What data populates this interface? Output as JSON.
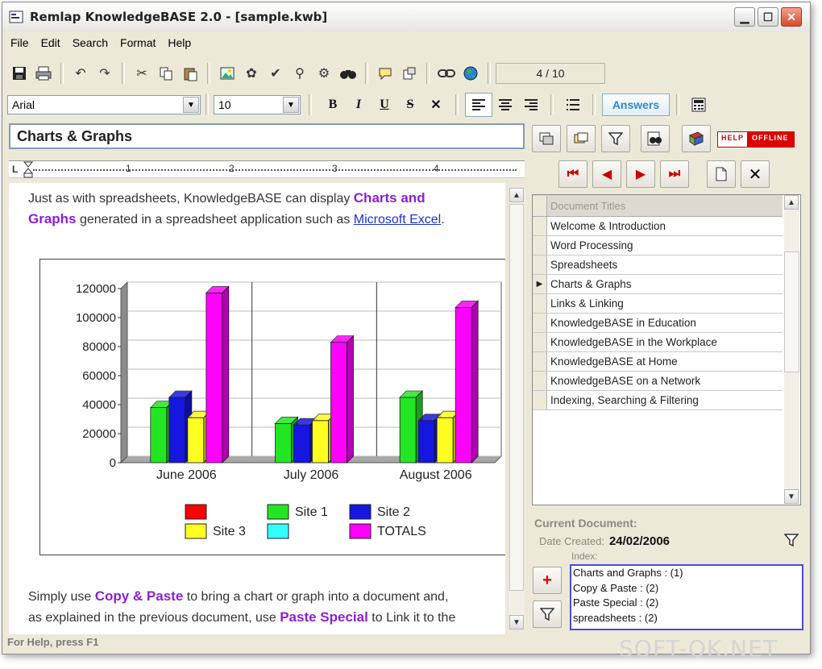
{
  "window": {
    "title": "Remlap KnowledgeBASE 2.0  -  [sample.kwb]"
  },
  "menu": {
    "items": [
      "File",
      "Edit",
      "Search",
      "Format",
      "Help"
    ]
  },
  "toolbar": {
    "page_indicator": "4 / 10"
  },
  "format_toolbar": {
    "font_name": "Arial",
    "font_size": "10",
    "answers_label": "Answers"
  },
  "document": {
    "title": "Charts & Graphs",
    "intro_text_1": "Just as with spreadsheets, KnowledgeBASE can display ",
    "intro_highlight_1": "Charts and",
    "intro_highlight_2": "Graphs",
    "intro_text_2": " generated in a spreadsheet application such as ",
    "intro_link": "Microsoft Excel",
    "intro_text_3": ".",
    "outro_text_1": "Simply use ",
    "outro_highlight_1": "Copy & Paste",
    "outro_text_2": " to bring a chart or graph into a document and,",
    "outro_text_3": "as explained in the previous document, use ",
    "outro_highlight_2": "Paste Special",
    "outro_text_4": " to Link it to the"
  },
  "ruler": {
    "marks": [
      "1",
      "2",
      "3",
      "4"
    ]
  },
  "chart_data": {
    "type": "bar",
    "categories": [
      "June 2006",
      "July 2006",
      "August 2006"
    ],
    "series": [
      {
        "name": "",
        "color": "#ff0000",
        "values": [
          0,
          0,
          0
        ]
      },
      {
        "name": "Site 1",
        "color": "#22e622",
        "values": [
          38000,
          27000,
          45000
        ]
      },
      {
        "name": "Site 2",
        "color": "#1616e0",
        "values": [
          45000,
          26000,
          29000
        ]
      },
      {
        "name": "Site 3",
        "color": "#ffff22",
        "values": [
          31000,
          29000,
          31000
        ]
      },
      {
        "name": "",
        "color": "#33ffff",
        "values": [
          0,
          0,
          0
        ]
      },
      {
        "name": "TOTALS",
        "color": "#ff00ff",
        "values": [
          117000,
          83000,
          107000
        ]
      }
    ],
    "ylim": [
      0,
      120000
    ],
    "yticks": [
      "0",
      "20000",
      "40000",
      "60000",
      "80000",
      "100000",
      "120000"
    ],
    "grid": true,
    "legend": "bottom"
  },
  "doc_list": {
    "header": "Document Titles",
    "items": [
      "Welcome & Introduction",
      "Word Processing",
      "Spreadsheets",
      "Charts & Graphs",
      "Links & Linking",
      "KnowledgeBASE in Education",
      "KnowledgeBASE in the Workplace",
      "KnowledgeBASE at Home",
      "KnowledgeBASE on a Network",
      "Indexing, Searching & Filtering"
    ],
    "selected_index": 3
  },
  "current_document": {
    "label": "Current Document:",
    "date_label": "Date Created:",
    "date_value": "24/02/2006",
    "index_label": "Index:",
    "index_entries": [
      "Charts and Graphs : (1)",
      "Copy & Paste : (2)",
      "Paste Special : (2)",
      "spreadsheets : (2)"
    ]
  },
  "help_badge": {
    "left": "HELP",
    "right": "OFFLINE"
  },
  "status": {
    "text": "For Help, press F1"
  },
  "watermark": {
    "text": "SOFT-OK.NET"
  }
}
